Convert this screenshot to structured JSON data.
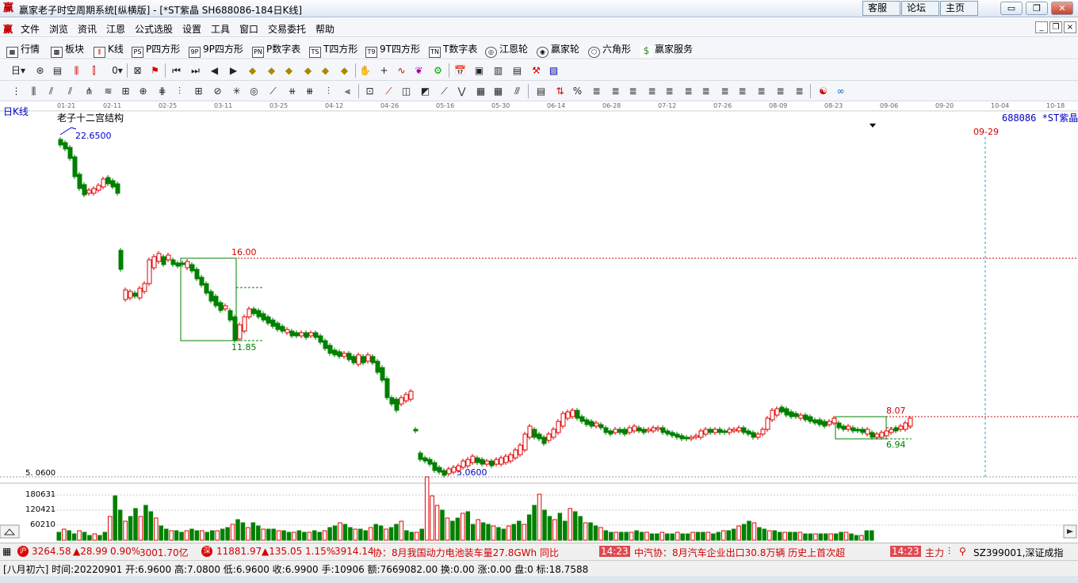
{
  "window": {
    "title": "赢家老子时空周期系统[纵横版] - [*ST紫晶   SH688086-184日K线]",
    "app_icon": "赢",
    "top_buttons": [
      "客服",
      "论坛",
      "主页"
    ],
    "win_controls": [
      "▭",
      "❐",
      "✕"
    ]
  },
  "menu": {
    "app_icon": "赢",
    "items": [
      "文件",
      "浏览",
      "资讯",
      "江恩",
      "公式选股",
      "设置",
      "工具",
      "窗口",
      "交易委托",
      "帮助"
    ],
    "mdi_controls": [
      "_",
      "❐",
      "×"
    ]
  },
  "toolbar1": {
    "items": [
      {
        "icon": "grid-icon",
        "glyph": "▦",
        "label": "行情"
      },
      {
        "icon": "blocks-icon",
        "glyph": "▩",
        "label": "板块"
      },
      {
        "icon": "kline-icon",
        "glyph": "⫼",
        "label": "K线"
      },
      {
        "icon": "ps-icon",
        "glyph": "PS",
        "label": "P四方形"
      },
      {
        "icon": "9p-icon",
        "glyph": "9P",
        "label": "9P四方形"
      },
      {
        "icon": "pn-icon",
        "glyph": "PN",
        "label": "P数字表"
      },
      {
        "icon": "ts-icon",
        "glyph": "TS",
        "label": "T四方形"
      },
      {
        "icon": "t9-icon",
        "glyph": "T9",
        "label": "9T四方形"
      },
      {
        "icon": "tn-icon",
        "glyph": "TN",
        "label": "T数字表"
      },
      {
        "icon": "gann-wheel-icon",
        "glyph": "◎",
        "label": "江恩轮"
      },
      {
        "icon": "winner-wheel-icon",
        "glyph": "◉",
        "label": "赢家轮"
      },
      {
        "icon": "hexagon-icon",
        "glyph": "⬡",
        "label": "六角形"
      },
      {
        "icon": "dollar-icon",
        "glyph": "$",
        "label": "赢家服务"
      }
    ]
  },
  "chart": {
    "period_label": "日K线",
    "overlay_title": "老子十二宫结构",
    "stock_label": "688086 *ST紫晶",
    "date_marker": "09-29",
    "dates": [
      "01-21",
      "02-11",
      "02-25",
      "03-11",
      "03-25",
      "04-12",
      "04-26",
      "05-16",
      "05-30",
      "06-14",
      "06-28",
      "07-12",
      "07-26",
      "08-09",
      "08-23",
      "09-06",
      "09-20",
      "10-04",
      "10-18"
    ],
    "price_labels": {
      "high": "22.6500",
      "level_16": "16.00",
      "level_1185": "11.85",
      "low": "5.0600",
      "low_axis": "5. 0600",
      "box_top": "8.07",
      "box_bottom": "6.94"
    },
    "volume_axis": [
      "180631",
      "120421",
      "60210"
    ],
    "colors": {
      "up": "#e00000",
      "down": "#008000",
      "box": "#008000",
      "dotline": "#d00000",
      "marker": "#1aa0c0"
    }
  },
  "status": {
    "sh_index": "3264.58",
    "sh_change": "▲28.99",
    "sh_pct": "0.90%",
    "sh_amount": "3001.70亿",
    "sz_index": "11881.97",
    "sz_change": "▲135.05",
    "sz_pct": "1.15%",
    "sz_amount": "3914.14",
    "news1": "协：8月我国动力电池装车量27.8GWh 同比",
    "time1": "14:23",
    "news2": "中汽协：8月汽车企业出口30.8万辆 历史上首次超",
    "time2": "14:23",
    "news3": "主力",
    "sz_code": "SZ399001,深证成指"
  },
  "bottom": {
    "text": "[八月初六] 时间:20220901 开:6.9600 高:7.0800 低:6.9600 收:6.9900 手:10906 额:7669082.00 换:0.00 涨:0.00 盘:0 标:18.7588"
  }
}
